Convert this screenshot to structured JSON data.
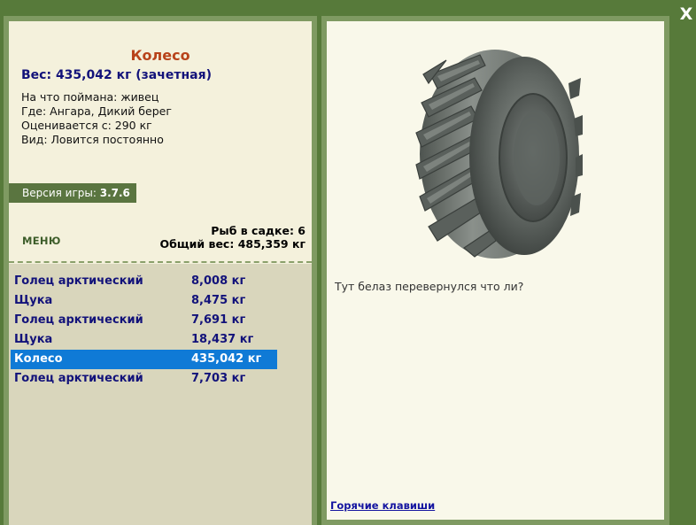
{
  "close_label": "X",
  "fish": {
    "title": "Колесо",
    "weight_line": "Вес: 435,042 кг (зачетная)",
    "caught_with": "На что поймана: живец",
    "location": "Где: Ангара, Дикий берег",
    "rated_from": "Оценивается с: 290 кг",
    "kind": "Вид: Ловится постоянно"
  },
  "version": {
    "label": "Версия игры:",
    "value": "3.7.6"
  },
  "menu_label": "МЕНЮ",
  "catch": {
    "count_line": "Рыб в садке: 6",
    "total_line": "Общий вес: 485,359 кг"
  },
  "fish_list": [
    {
      "name": "Голец арктический",
      "weight": "8,008 кг"
    },
    {
      "name": "Щука",
      "weight": "8,475 кг"
    },
    {
      "name": "Голец арктический",
      "weight": "7,691 кг"
    },
    {
      "name": "Щука",
      "weight": "18,437 кг"
    },
    {
      "name": "Колесо",
      "weight": "435,042 кг"
    },
    {
      "name": "Голец арктический",
      "weight": "7,703 кг"
    }
  ],
  "selected_index": 4,
  "comment": "Тут белаз перевернулся что ли?",
  "hotkeys_label": "Горячие клавиши",
  "image_icon": "tire-image",
  "colors": {
    "frame_green": "#577a3a",
    "title_orange": "#b8431a",
    "text_navy": "#12127a",
    "selection_blue": "#0f7ad6"
  }
}
